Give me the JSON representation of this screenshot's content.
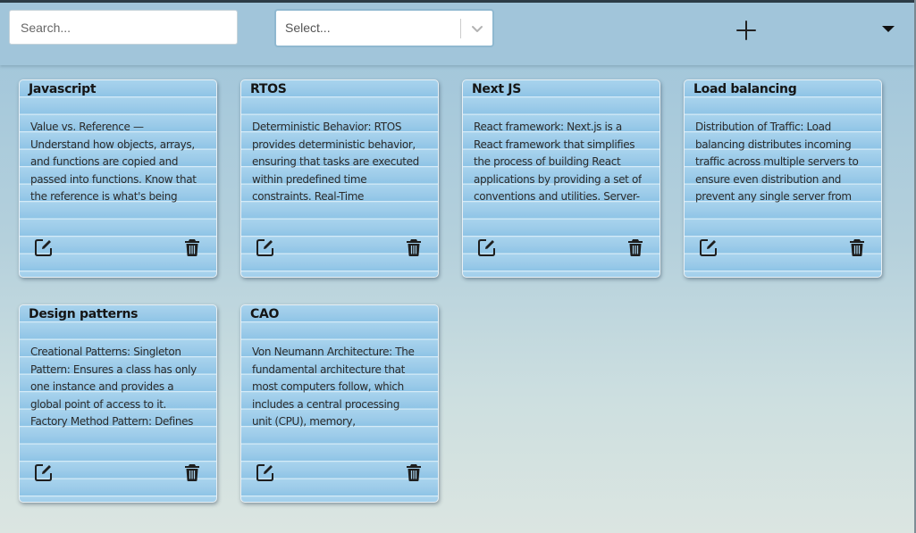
{
  "toolbar": {
    "search_placeholder": "Search...",
    "select_placeholder": "Select...",
    "add_icon": "plus-icon",
    "menu_icon": "caret-down-icon"
  },
  "colors": {
    "background_top": "#9ec4da",
    "background_bottom": "#dbe5e1",
    "card_line_blue": "#8ec4e6",
    "icon_dark": "#1e1e1e"
  },
  "cards": [
    {
      "title": "Javascript",
      "body": "Value vs. Reference — Understand how objects, arrays, and functions are copied and passed into functions. Know that the reference is what's being copied, and understand the difference between primitives and objects."
    },
    {
      "title": "RTOS",
      "body": "Deterministic Behavior: RTOS provides deterministic behavior, ensuring that tasks are executed within predefined time constraints. Real-Time Scheduling: RTOS use scheduling algorithms to prioritize tasks."
    },
    {
      "title": "Next JS",
      "body": "React framework: Next.js is a React framework that simplifies the process of building React applications by providing a set of conventions and utilities. Server-Side Rendering (SSR): Next.js supports SSR."
    },
    {
      "title": "Load balancing",
      "body": "Distribution of Traffic: Load balancing distributes incoming traffic across multiple servers to ensure even distribution and prevent any single server from becoming overwhelmed by requests."
    },
    {
      "title": "Design patterns",
      "body": "Creational Patterns: Singleton Pattern: Ensures a class has only one instance and provides a global point of access to it. Factory Method Pattern: Defines an interface for creating an object."
    },
    {
      "title": "CAO",
      "body": "Von Neumann Architecture: The fundamental architecture that most computers follow, which includes a central processing unit (CPU), memory, input/output devices, and a bus system."
    }
  ]
}
